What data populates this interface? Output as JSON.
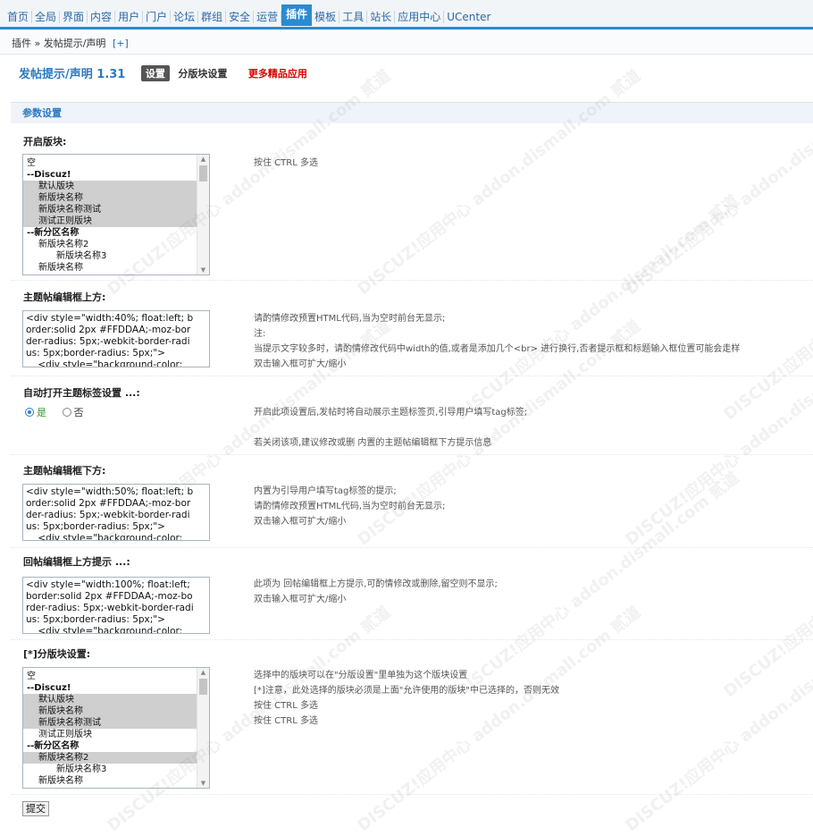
{
  "nav": {
    "items": [
      "首页",
      "全局",
      "界面",
      "内容",
      "用户",
      "门户",
      "论坛",
      "群组",
      "安全",
      "运营",
      "插件",
      "模板",
      "工具",
      "站长",
      "应用中心",
      "UCenter"
    ],
    "active_index": 10
  },
  "breadcrumb": {
    "text": "插件 » 发帖提示/声明",
    "plus": "[+]"
  },
  "title": {
    "plugin": "发帖提示/声明 1.31",
    "tab_active": "设置",
    "tab_other": "分版块设置",
    "more": "更多精品应用"
  },
  "section": {
    "title": "参数设置"
  },
  "forum_open": {
    "label": "开启版块:",
    "hint": "按住 CTRL 多选",
    "options": [
      {
        "text": "空",
        "level": 0,
        "group": false,
        "selected": false
      },
      {
        "text": "--Discuz!",
        "level": 0,
        "group": true,
        "selected": false
      },
      {
        "text": "默认版块",
        "level": 1,
        "group": false,
        "selected": true
      },
      {
        "text": "新版块名称",
        "level": 1,
        "group": false,
        "selected": true
      },
      {
        "text": "新版块名称测试",
        "level": 1,
        "group": false,
        "selected": true
      },
      {
        "text": "测试正则版块",
        "level": 1,
        "group": false,
        "selected": true
      },
      {
        "text": "--新分区名称",
        "level": 0,
        "group": true,
        "selected": false
      },
      {
        "text": "新版块名称2",
        "level": 1,
        "group": false,
        "selected": false
      },
      {
        "text": "新版块名称3",
        "level": 2,
        "group": false,
        "selected": false
      },
      {
        "text": "新版块名称",
        "level": 1,
        "group": false,
        "selected": false
      }
    ]
  },
  "thread_above": {
    "label": "主题帖编辑框上方:",
    "value": "<div style=\"width:40%; float:left; border:solid 2px #FFDDAA;-moz-border-radius: 5px;-webkit-border-radius: 5px;border-radius: 5px;\">\n    <div style=\"background-color:",
    "hints": [
      "请酌情修改预置HTML代码,当为空时前台无显示;",
      "注:",
      "当提示文字较多时，请酌情修改代码中width的值,或者是添加几个<br> 进行换行,否者提示框和标题输入框位置可能会走样",
      "双击输入框可扩大/缩小"
    ]
  },
  "auto_tag": {
    "label": "自动打开主题标签设置 ...:",
    "yes": "是",
    "no": "否",
    "hints": [
      "开启此项设置后,发帖时将自动展示主题标签页,引导用户填写tag标签;",
      "若关闭该项,建议修改或删 内置的主题帖编辑框下方提示信息"
    ]
  },
  "thread_below": {
    "label": "主题帖编辑框下方:",
    "value": "<div style=\"width:50%; float:left; border:solid 2px #FFDDAA;-moz-border-radius: 5px;-webkit-border-radius: 5px;border-radius: 5px;\">\n    <div style=\"background-color:",
    "hints": [
      "内置为引导用户填写tag标签的提示;",
      "请酌情修改预置HTML代码,当为空时前台无显示;",
      "双击输入框可扩大/缩小"
    ]
  },
  "reply_above": {
    "label": "回帖编辑框上方提示 ...:",
    "value": "<div style=\"width:100%; float:left; border:solid 2px #FFDDAA;-moz-border-radius: 5px;-webkit-border-radius: 5px;border-radius: 5px;\">\n    <div style=\"background-color:",
    "hints": [
      "此项为 回帖编辑框上方提示,可酌情修改或删除,留空则不显示;",
      "双击输入框可扩大/缩小"
    ]
  },
  "forum_split": {
    "label": "[*]分版块设置:",
    "hints": [
      "选择中的版块可以在\"分版设置\"里单独为这个版块设置",
      "[*]注意，此处选择的版块必须是上面\"允许使用的版块\"中已选择的，否则无效",
      "按住 CTRL 多选",
      "按住 CTRL 多选"
    ],
    "options": [
      {
        "text": "空",
        "level": 0,
        "group": false,
        "selected": false
      },
      {
        "text": "--Discuz!",
        "level": 0,
        "group": true,
        "selected": false
      },
      {
        "text": "默认版块",
        "level": 1,
        "group": false,
        "selected": true
      },
      {
        "text": "新版块名称",
        "level": 1,
        "group": false,
        "selected": true
      },
      {
        "text": "新版块名称测试",
        "level": 1,
        "group": false,
        "selected": true
      },
      {
        "text": "测试正则版块",
        "level": 1,
        "group": false,
        "selected": false
      },
      {
        "text": "--新分区名称",
        "level": 0,
        "group": true,
        "selected": false
      },
      {
        "text": "新版块名称2",
        "level": 1,
        "group": false,
        "selected": true
      },
      {
        "text": "新版块名称3",
        "level": 2,
        "group": false,
        "selected": false
      },
      {
        "text": "新版块名称",
        "level": 1,
        "group": false,
        "selected": false
      }
    ]
  },
  "submit": {
    "label": "提交"
  },
  "watermark": "DISCUZ!应用中心 addon.dismall.com 贰道"
}
